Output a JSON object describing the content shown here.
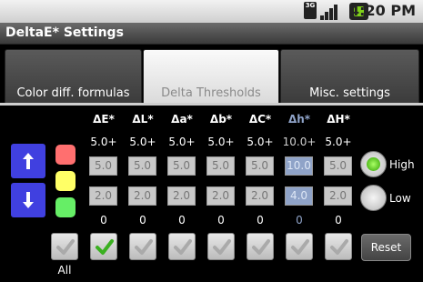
{
  "status_bar": {
    "network_label": "3G",
    "time": "4:20 PM"
  },
  "title_bar": {
    "title": "DeltaE* Settings"
  },
  "tabs": [
    {
      "label": "Color diff. formulas",
      "active": false
    },
    {
      "label": "Delta Thresholds",
      "active": true
    },
    {
      "label": "Misc. settings",
      "active": false
    }
  ],
  "columns": [
    {
      "name": "ΔE*",
      "max_label": "5.0+",
      "max_value": "5.0",
      "min_value": "2.0",
      "min_label": "0",
      "checked": true,
      "highlighted": false
    },
    {
      "name": "ΔL*",
      "max_label": "5.0+",
      "max_value": "5.0",
      "min_value": "2.0",
      "min_label": "0",
      "checked": false,
      "highlighted": false
    },
    {
      "name": "Δa*",
      "max_label": "5.0+",
      "max_value": "5.0",
      "min_value": "2.0",
      "min_label": "0",
      "checked": false,
      "highlighted": false
    },
    {
      "name": "Δb*",
      "max_label": "5.0+",
      "max_value": "5.0",
      "min_value": "2.0",
      "min_label": "0",
      "checked": false,
      "highlighted": false
    },
    {
      "name": "ΔC*",
      "max_label": "5.0+",
      "max_value": "5.0",
      "min_value": "2.0",
      "min_label": "0",
      "checked": false,
      "highlighted": false
    },
    {
      "name": "Δh*",
      "max_label": "10.0+",
      "max_value": "10.0",
      "min_value": "4.0",
      "min_label": "0",
      "checked": false,
      "highlighted": true
    },
    {
      "name": "ΔH*",
      "max_label": "5.0+",
      "max_value": "5.0",
      "min_value": "2.0",
      "min_label": "0",
      "checked": false,
      "highlighted": false
    }
  ],
  "swatch_colors": [
    "#ff6f6f",
    "#ffff66",
    "#66ee66"
  ],
  "accent_color": "#4040e0",
  "all_label": "All",
  "radio": {
    "high_label": "High",
    "low_label": "Low",
    "selected": "high"
  },
  "reset_label": "Reset"
}
